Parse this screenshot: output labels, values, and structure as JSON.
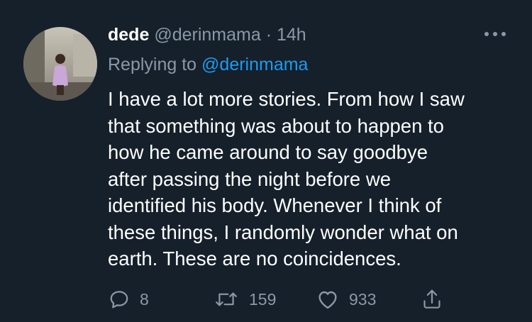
{
  "tweet": {
    "author_name": "dede",
    "author_handle": "@derinmama",
    "separator": "·",
    "time": "14h",
    "replying_prefix": "Replying to",
    "replying_handle": "@derinmama",
    "text_lines": [
      "I have a lot more stories. From how I saw",
      "that something was about to happen to",
      "how he came around to say goodbye",
      "after passing the night before we",
      "identified his body. Whenever I think of",
      "these things, I randomly wonder what on",
      "earth. These are no coincidences."
    ]
  },
  "actions": {
    "replies": "8",
    "retweets": "159",
    "likes": "933"
  },
  "icons": {
    "more": "more-dots-icon",
    "reply": "reply-bubble-icon",
    "retweet": "retweet-icon",
    "like": "heart-icon",
    "share": "share-icon"
  },
  "colors": {
    "background": "#15202b",
    "text": "#ffffff",
    "secondary": "#8b98a5",
    "link": "#1d9bf0"
  }
}
